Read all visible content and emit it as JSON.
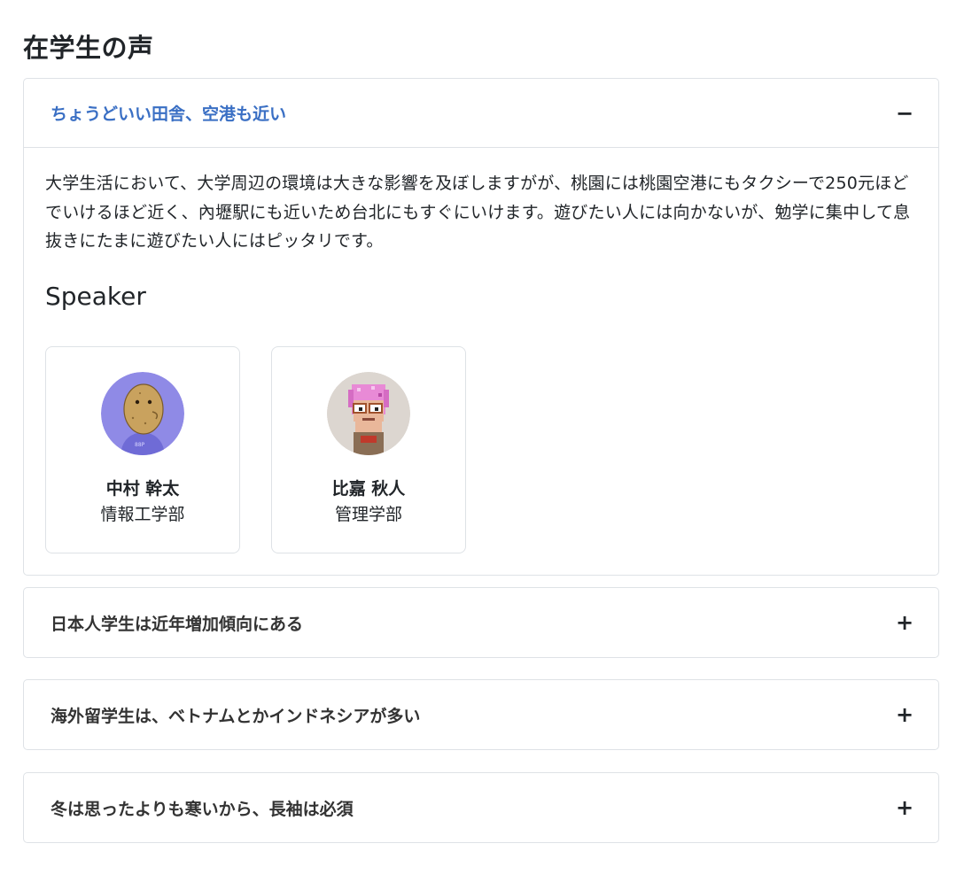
{
  "page_title": "在学生の声",
  "accordions": [
    {
      "title": "ちょうどいい田舎、空港も近い",
      "toggle": "−",
      "expanded": true,
      "body": "大学生活において、大学周辺の環境は大きな影響を及ぼしますがが、桃園には桃園空港にもタクシーで250元ほどでいけるほど近く、內壢駅にも近いため台北にもすぐにいけます。遊びたい人には向かないが、勉学に集中して息抜きにたまに遊びたい人にはピッタリです。",
      "speaker_heading": "Speaker",
      "speakers": [
        {
          "name": "中村 幹太",
          "department": "情報工学部",
          "avatar_icon": "potato-character-avatar"
        },
        {
          "name": "比嘉 秋人",
          "department": "管理学部",
          "avatar_icon": "pixel-character-avatar"
        }
      ]
    },
    {
      "title": "日本人学生は近年増加傾向にある",
      "toggle": "+",
      "expanded": false
    },
    {
      "title": "海外留学生は、ベトナムとかインドネシアが多い",
      "toggle": "+",
      "expanded": false
    },
    {
      "title": "冬は思ったよりも寒いから、長袖は必須",
      "toggle": "+",
      "expanded": false
    }
  ],
  "colors": {
    "accent": "#3a6fc4",
    "border": "#dee2e6",
    "text": "#212529"
  }
}
